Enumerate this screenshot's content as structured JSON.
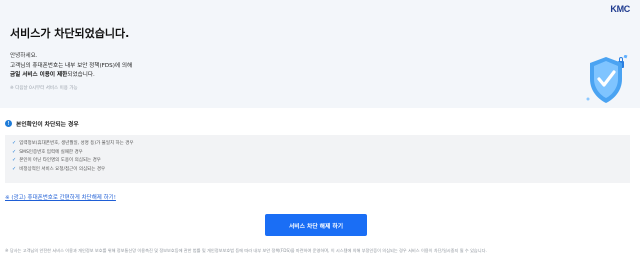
{
  "header": {
    "logo": "KMC",
    "title": "서비스가 차단되었습니다.",
    "greeting": "안녕하세요.",
    "desc_line1": "고객님의 휴대폰번호는 내부 보안 정책(FDS)에 의해",
    "desc_line2_bold": "금일 서비스 이용이 제한",
    "desc_line2_rest": "되었습니다.",
    "note": "※ 다음날 0시부터 서비스 이용 가능"
  },
  "section": {
    "title": "본인확인이 차단되는 경우",
    "reasons": [
      "입력정보(휴대폰번호, 생년월일, 성명 등)가 불일치 하는 경우",
      "SMS인증번호 입력에 실패한 경우",
      "본인이 아닌 타인명의 도용이 의심되는 경우",
      "비정상적인 서비스 요청/접근이 의심되는 경우"
    ]
  },
  "ad_link": "※ (광고) 휴대폰번호로 간편하게 차단해제 하기!",
  "unblock_button": "서비스 차단 해제 하기",
  "footer": "※ 당사는 고객님의 안전한 서비스 이용과 개인정보 보호를 위해 정보통신망 이용촉진 및 정보보호등에 관한 법률 및 개인정보보호법 등에 따라 내부 보안 정책(FDS)을 마련하여 운영하며, 이 시스템에 의해 부정인증이 의심되는 경우 서비스 이용이 차단/일시중지 될 수 있습니다.",
  "colors": {
    "accent": "#1a6ef5",
    "hero_bg": "#f3f6fa",
    "panel_bg": "#f2f3f5"
  }
}
